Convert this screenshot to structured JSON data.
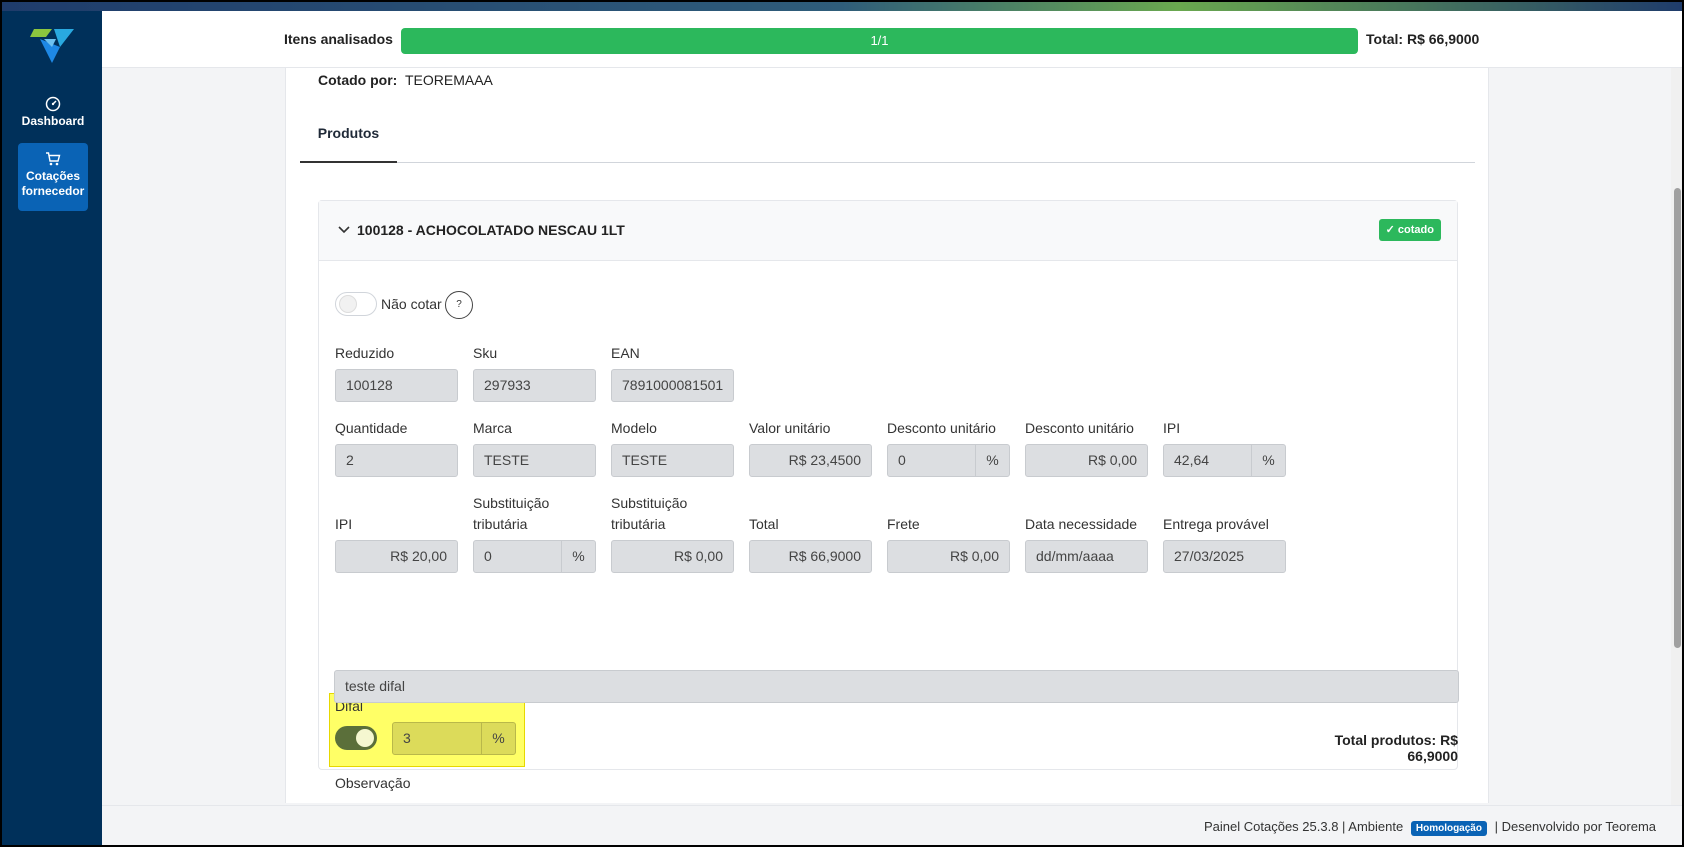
{
  "sidebar": {
    "items": [
      {
        "label": "Dashboard",
        "icon": "gauge-icon"
      },
      {
        "label": "Cotações fornecedor",
        "icon": "cart-icon"
      }
    ]
  },
  "header": {
    "progress_label": "Itens analisados",
    "progress_text": "1/1",
    "progress_fraction": 1.0,
    "total": "Total: R$ 66,9000"
  },
  "quote": {
    "cotado_por_label": "Cotado por:",
    "cotado_por_value": "TEOREMAAA",
    "tab_label": "Produtos"
  },
  "product": {
    "title": "100128 - ACHOCOLATADO NESCAU 1LT",
    "status_badge": "✓ cotado",
    "nao_cotar_label": "Não cotar",
    "help_symbol": "?",
    "fields": {
      "reduzido": {
        "label": "Reduzido",
        "value": "100128"
      },
      "sku": {
        "label": "Sku",
        "value": "297933"
      },
      "ean": {
        "label": "EAN",
        "value": "7891000081501"
      },
      "quantidade": {
        "label": "Quantidade",
        "value": "2"
      },
      "marca": {
        "label": "Marca",
        "value": "TESTE"
      },
      "modelo": {
        "label": "Modelo",
        "value": "TESTE"
      },
      "valor_unitario": {
        "label": "Valor unitário",
        "value": "R$ 23,4500"
      },
      "desconto_pct": {
        "label": "Desconto unitário",
        "value": "0",
        "suffix": "%"
      },
      "desconto_valor": {
        "label": "Desconto unitário",
        "value": "R$ 0,00"
      },
      "ipi_pct": {
        "label": "IPI",
        "value": "42,64",
        "suffix": "%"
      },
      "ipi_valor": {
        "label": "IPI",
        "value": "R$ 20,00"
      },
      "subst_pct": {
        "label_line1": "Substituição",
        "label_line2": "tributária",
        "value": "0",
        "suffix": "%"
      },
      "subst_valor": {
        "label_line1": "Substituição",
        "label_line2": "tributária",
        "value": "R$ 0,00"
      },
      "total": {
        "label": "Total",
        "value": "R$ 66,9000"
      },
      "frete": {
        "label": "Frete",
        "value": "R$  0,00"
      },
      "data_necessidade": {
        "label": "Data necessidade",
        "value": "dd/mm/aaaa"
      },
      "entrega_provavel": {
        "label": "Entrega provável",
        "value": "27/03/2025"
      },
      "difal": {
        "label": "Difal",
        "value": "3",
        "suffix": "%",
        "enabled": true
      },
      "observacao": {
        "label": "Observação",
        "value": "teste difal"
      }
    },
    "total_produtos": "Total produtos: R$ 66,9000"
  },
  "footer": {
    "app_version": "Painel Cotações  25.3.8  |  Ambiente",
    "environment": "Homologação",
    "developer": "|  Desenvolvido por Teorema"
  },
  "colors": {
    "sidebar_bg": "#00305a",
    "active_nav": "#0a63b5",
    "progress": "#2cb85c",
    "highlight": "#ffff66"
  }
}
